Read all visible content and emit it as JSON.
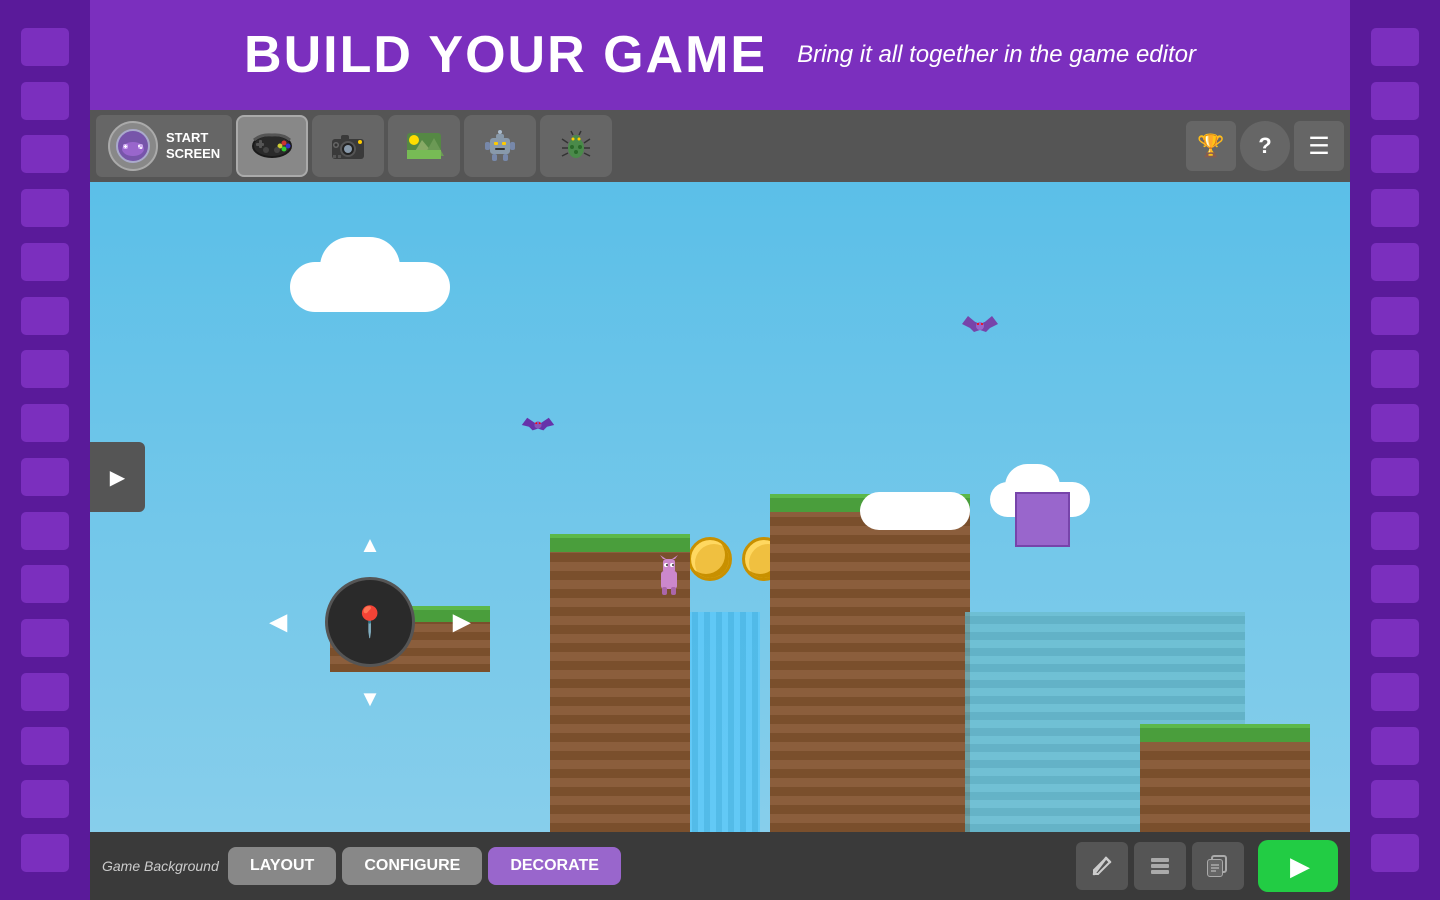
{
  "header": {
    "title": "BUILD YoUR GAME",
    "subtitle": "Bring it all together in the game editor"
  },
  "toolbar": {
    "start_label": "START\nSCREEN",
    "tabs": [
      {
        "id": "gamepad",
        "icon": "🎮",
        "active": true
      },
      {
        "id": "camera",
        "icon": "📷"
      },
      {
        "id": "landscape",
        "icon": "🏔️"
      },
      {
        "id": "robot",
        "icon": "🤖"
      },
      {
        "id": "bug",
        "icon": "🐞"
      }
    ],
    "end_buttons": [
      {
        "id": "trophy",
        "icon": "🏆"
      },
      {
        "id": "help",
        "icon": "❓"
      },
      {
        "id": "menu",
        "icon": "☰"
      }
    ]
  },
  "game_canvas": {
    "label": "game area"
  },
  "bottom_toolbar": {
    "background_label": "Game Background",
    "buttons": [
      {
        "id": "layout",
        "label": "LAYOUT"
      },
      {
        "id": "configure",
        "label": "CONFIGURE"
      },
      {
        "id": "decorate",
        "label": "DECORate"
      }
    ],
    "icon_buttons": [
      {
        "id": "pencil",
        "icon": "✏️"
      },
      {
        "id": "layers",
        "icon": "📋"
      },
      {
        "id": "copy",
        "icon": "📄"
      }
    ],
    "play_label": "▶"
  },
  "film_holes": [
    1,
    2,
    3,
    4,
    5,
    6,
    7,
    8,
    9,
    10,
    11,
    12,
    13,
    14,
    15,
    16
  ]
}
